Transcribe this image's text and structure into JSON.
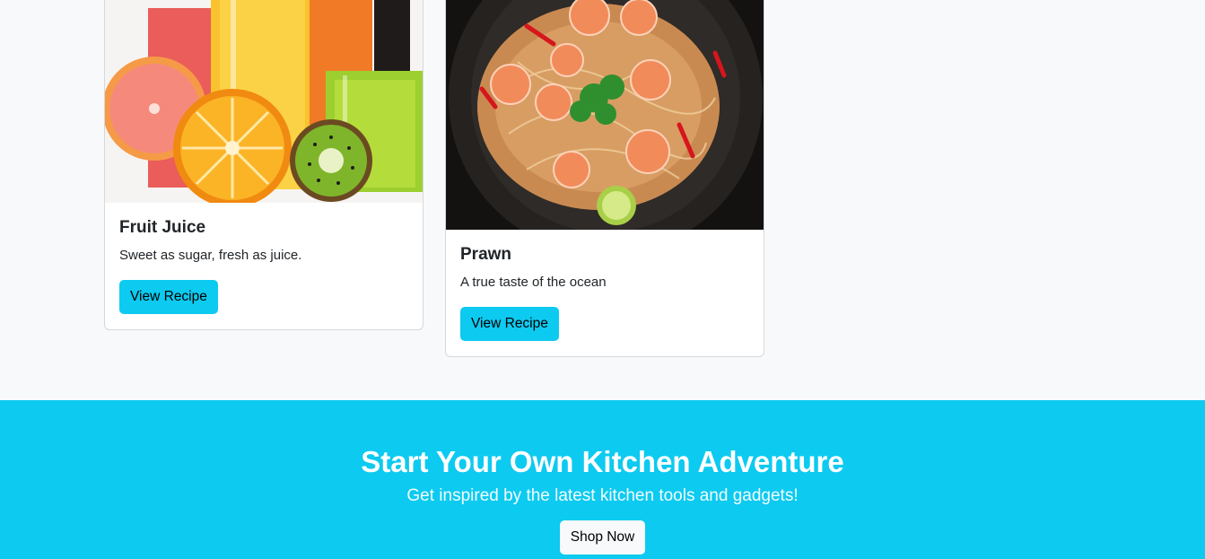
{
  "recipes": [
    {
      "title": "Fruit Juice",
      "description": "Sweet as sugar, fresh as juice.",
      "button_label": "View Recipe",
      "image": "fruit-juice-photo"
    },
    {
      "title": "Prawn",
      "description": "A true taste of the ocean",
      "button_label": "View Recipe",
      "image": "prawn-noodles-photo"
    }
  ],
  "banner": {
    "heading": "Start Your Own Kitchen Adventure",
    "subheading": "Get inspired by the latest kitchen tools and gadgets!",
    "button_label": "Shop Now",
    "background_color": "#0dcaf0"
  },
  "colors": {
    "accent": "#0dcaf0",
    "page_background": "#f8f9fa"
  }
}
